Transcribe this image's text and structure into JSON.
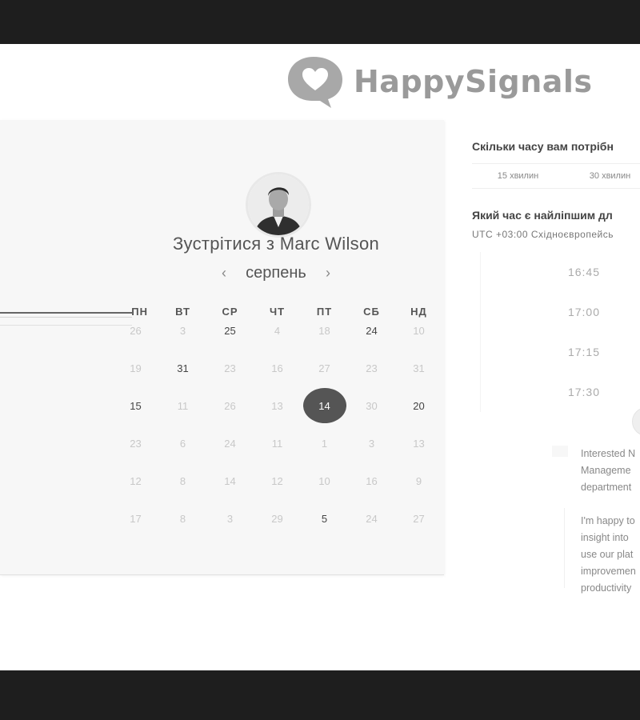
{
  "logo": {
    "text": "HappySignals"
  },
  "calendar": {
    "meeting_title": "Зустрітися з Marc Wilson",
    "month": "серпень",
    "prev_icon": "chevron-left-icon",
    "next_icon": "chevron-right-icon",
    "weekdays": [
      "ПН",
      "ВТ",
      "СР",
      "ЧТ",
      "ПТ",
      "СБ",
      "НД"
    ],
    "weeks": [
      [
        {
          "d": "26",
          "s": "inactive"
        },
        {
          "d": "3",
          "s": "inactive"
        },
        {
          "d": "25",
          "s": "active"
        },
        {
          "d": "4",
          "s": "inactive"
        },
        {
          "d": "18",
          "s": "inactive"
        },
        {
          "d": "24",
          "s": "active"
        },
        {
          "d": "10",
          "s": "inactive"
        }
      ],
      [
        {
          "d": "19",
          "s": "inactive"
        },
        {
          "d": "31",
          "s": "active"
        },
        {
          "d": "23",
          "s": "inactive"
        },
        {
          "d": "16",
          "s": "inactive"
        },
        {
          "d": "27",
          "s": "inactive"
        },
        {
          "d": "23",
          "s": "inactive"
        },
        {
          "d": "31",
          "s": "inactive"
        }
      ],
      [
        {
          "d": "15",
          "s": "active"
        },
        {
          "d": "11",
          "s": "inactive"
        },
        {
          "d": "26",
          "s": "inactive"
        },
        {
          "d": "13",
          "s": "inactive"
        },
        {
          "d": "14",
          "s": "selected"
        },
        {
          "d": "30",
          "s": "inactive"
        },
        {
          "d": "20",
          "s": "active"
        }
      ],
      [
        {
          "d": "23",
          "s": "inactive"
        },
        {
          "d": "6",
          "s": "inactive"
        },
        {
          "d": "24",
          "s": "inactive"
        },
        {
          "d": "11",
          "s": "inactive"
        },
        {
          "d": "1",
          "s": "inactive"
        },
        {
          "d": "3",
          "s": "inactive"
        },
        {
          "d": "13",
          "s": "inactive"
        }
      ],
      [
        {
          "d": "12",
          "s": "inactive"
        },
        {
          "d": "8",
          "s": "inactive"
        },
        {
          "d": "14",
          "s": "inactive"
        },
        {
          "d": "12",
          "s": "inactive"
        },
        {
          "d": "10",
          "s": "inactive"
        },
        {
          "d": "16",
          "s": "inactive"
        },
        {
          "d": "9",
          "s": "inactive"
        }
      ],
      [
        {
          "d": "17",
          "s": "inactive"
        },
        {
          "d": "8",
          "s": "inactive"
        },
        {
          "d": "3",
          "s": "inactive"
        },
        {
          "d": "29",
          "s": "inactive"
        },
        {
          "d": "5",
          "s": "active"
        },
        {
          "d": "24",
          "s": "inactive"
        },
        {
          "d": "27",
          "s": "inactive"
        }
      ]
    ]
  },
  "booking": {
    "duration_question": "Скільки часу вам потрібн",
    "durations": [
      "15 хвилин",
      "30 хвилин"
    ],
    "time_question": "Який час є найліпшим дл",
    "timezone": "UTC +03:00 Східноєвропейсь",
    "slots": [
      "16:45",
      "17:00",
      "17:15",
      "17:30"
    ],
    "description": [
      [
        "Interested N",
        "Manageme",
        "department"
      ],
      [
        "I'm happy to",
        "insight into",
        "use our plat",
        "improvemen",
        "productivity"
      ]
    ]
  },
  "colors": {
    "selected_day": "#555555",
    "card_bg": "#f7f7f7",
    "logo": "#9a9a9a"
  }
}
